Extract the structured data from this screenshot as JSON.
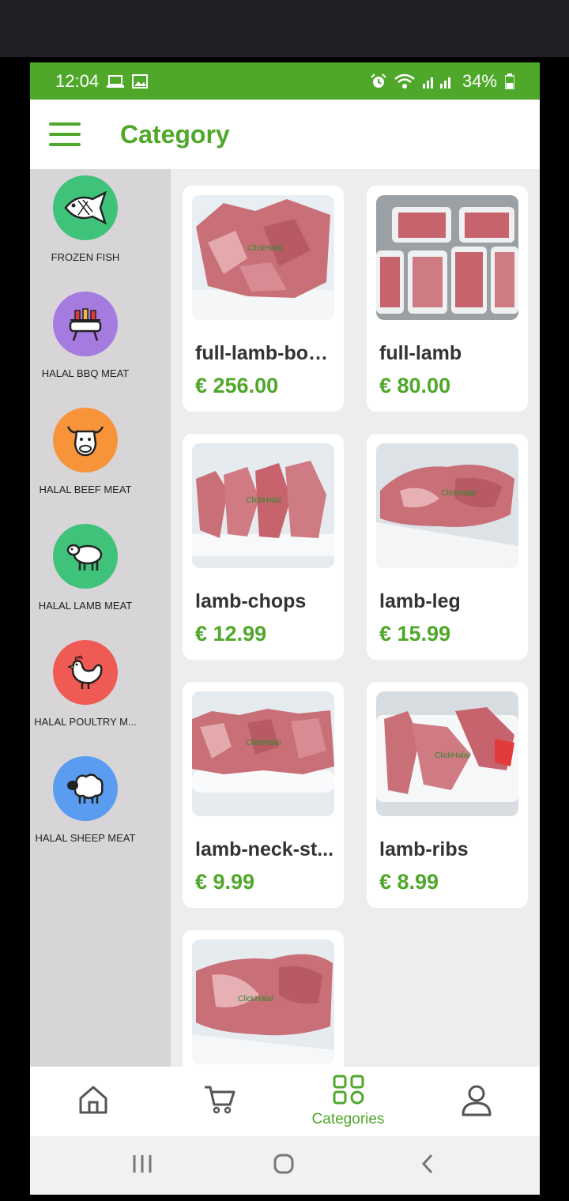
{
  "status_bar": {
    "time": "12:04",
    "battery": "34%"
  },
  "app_bar": {
    "title": "Category"
  },
  "categories": [
    {
      "label": "FROZEN FISH",
      "icon": "fish-icon",
      "color": "#3fc27a"
    },
    {
      "label": "HALAL BBQ MEAT",
      "icon": "bbq-grill-icon",
      "color": "#a57be0"
    },
    {
      "label": "HALAL BEEF MEAT",
      "icon": "cow-icon",
      "color": "#f7943a"
    },
    {
      "label": "HALAL LAMB MEAT",
      "icon": "lamb-icon",
      "color": "#3fc27a"
    },
    {
      "label": "HALAL POULTRY M...",
      "icon": "chicken-icon",
      "color": "#f05a55"
    },
    {
      "label": "HALAL SHEEP MEAT",
      "icon": "sheep-icon",
      "color": "#5a9cf0"
    }
  ],
  "products": [
    {
      "name": "full-lamb-bon...",
      "price": "€ 256.00"
    },
    {
      "name": "full-lamb",
      "price": "€ 80.00"
    },
    {
      "name": "lamb-chops",
      "price": "€ 12.99"
    },
    {
      "name": "lamb-leg",
      "price": "€ 15.99"
    },
    {
      "name": "lamb-neck-st...",
      "price": "€ 9.99"
    },
    {
      "name": "lamb-ribs",
      "price": "€ 8.99"
    },
    {
      "name": "",
      "price": ""
    }
  ],
  "bottom_nav": {
    "active_label": "Categories"
  },
  "colors": {
    "brand_green": "#4fa82a",
    "sidebar_bg": "#d7d5d8",
    "grid_bg": "#eeeced"
  }
}
